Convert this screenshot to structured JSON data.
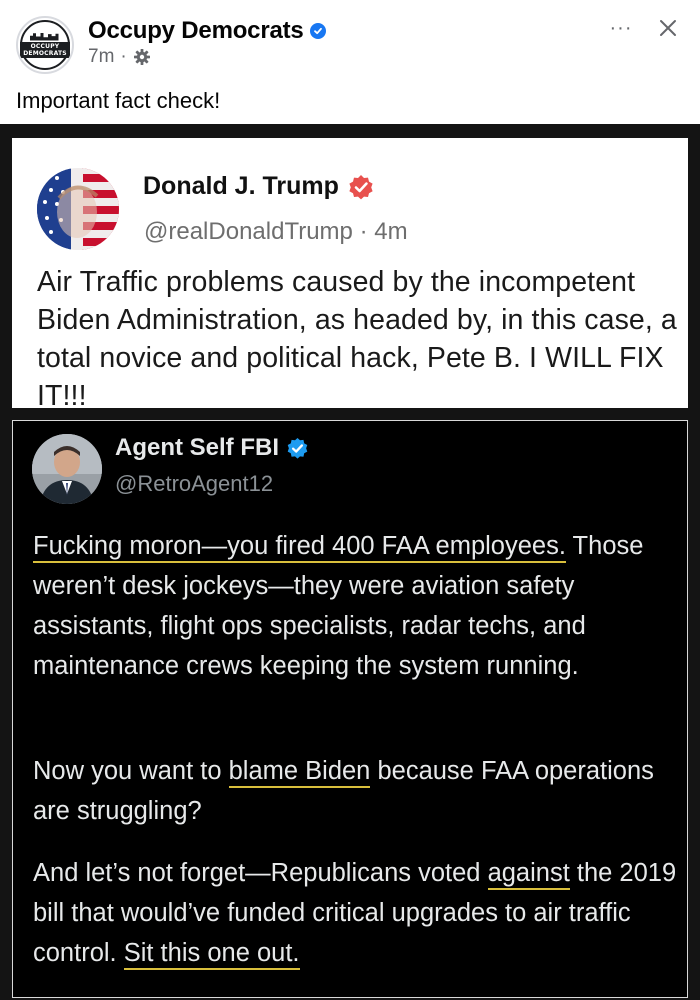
{
  "post": {
    "page_name": "Occupy Democrats",
    "avatar_text": "OCCUPY DEMOCRATS",
    "time": "7m",
    "separator": "·",
    "more_label": "···",
    "text": "Important fact check!"
  },
  "trump_post": {
    "name": "Donald J. Trump",
    "handle": "@realDonaldTrump",
    "separator": "·",
    "time": "4m",
    "text": "Air Traffic problems caused by the incompetent Biden Administration, as headed by, in this case, a total novice and political hack, Pete B. I WILL FIX IT!!!"
  },
  "reply_post": {
    "name": "Agent Self FBI",
    "handle": "@RetroAgent12",
    "p1_a": "Fucking moron—you fired 400 FAA employees.",
    "p1_b": " Those weren’t desk jockeys—they were aviation safety assistants, flight ops specialists, radar techs, and maintenance crews keeping the system running.",
    "p2_a": "Now you want to ",
    "p2_b": "blame Biden",
    "p2_c": " because FAA operations are struggling?",
    "p3_a": "And let’s not forget—Republicans voted ",
    "p3_b": "against",
    "p3_c": " the 2019 bill that would’ve funded critical upgrades to air traffic control. ",
    "p3_d": "Sit this one out."
  },
  "colors": {
    "facebook_blue": "#1877f2",
    "x_blue": "#1d9bf0",
    "truth_red": "#e8514e",
    "highlight_underline": "#d9bf3c"
  },
  "icons": {
    "verified": "verified-badge-icon",
    "gear": "gear-icon",
    "close": "close-icon",
    "more": "more-icon"
  }
}
